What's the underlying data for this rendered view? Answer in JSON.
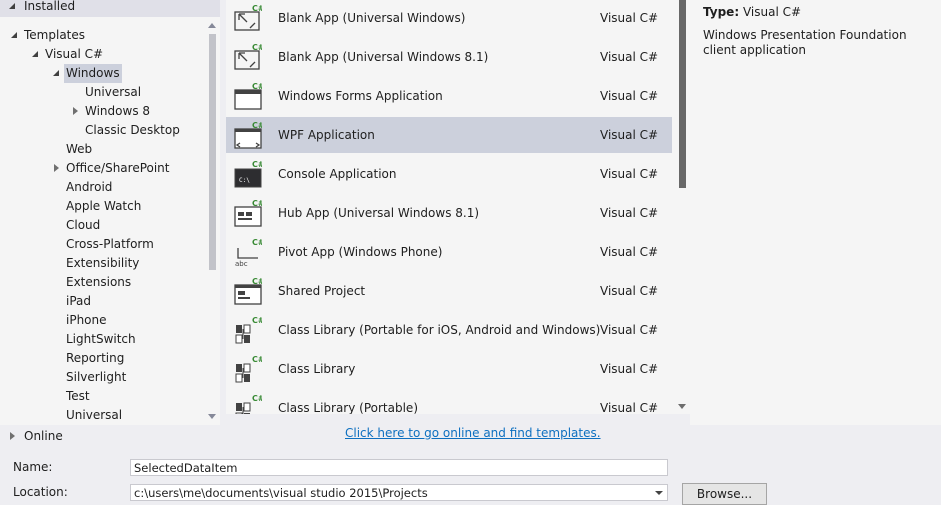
{
  "tree": {
    "installed": "Installed",
    "items": [
      {
        "label": "Templates",
        "state": "expanded"
      },
      {
        "label": "Visual C#",
        "state": "expanded"
      },
      {
        "label": "Windows",
        "state": "expanded",
        "selected": true
      },
      {
        "label": "Universal",
        "state": "leaf"
      },
      {
        "label": "Windows 8",
        "state": "collapsed"
      },
      {
        "label": "Classic Desktop",
        "state": "leaf"
      },
      {
        "label": "Web",
        "state": "leaf"
      },
      {
        "label": "Office/SharePoint",
        "state": "collapsed"
      },
      {
        "label": "Android",
        "state": "leaf"
      },
      {
        "label": "Apple Watch",
        "state": "leaf"
      },
      {
        "label": "Cloud",
        "state": "leaf"
      },
      {
        "label": "Cross-Platform",
        "state": "leaf"
      },
      {
        "label": "Extensibility",
        "state": "leaf"
      },
      {
        "label": "Extensions",
        "state": "leaf"
      },
      {
        "label": "iPad",
        "state": "leaf"
      },
      {
        "label": "iPhone",
        "state": "leaf"
      },
      {
        "label": "LightSwitch",
        "state": "leaf"
      },
      {
        "label": "Reporting",
        "state": "leaf"
      },
      {
        "label": "Silverlight",
        "state": "leaf"
      },
      {
        "label": "Test",
        "state": "leaf"
      },
      {
        "label": "Universal",
        "state": "leaf"
      }
    ],
    "online": "Online"
  },
  "templates": [
    {
      "name": "Blank App (Universal Windows)",
      "lang": "Visual C#",
      "icon": "blank-app-icon"
    },
    {
      "name": "Blank App (Universal Windows 8.1)",
      "lang": "Visual C#",
      "icon": "blank-app-icon"
    },
    {
      "name": "Windows Forms Application",
      "lang": "Visual C#",
      "icon": "window-icon"
    },
    {
      "name": "WPF Application",
      "lang": "Visual C#",
      "icon": "wpf-icon",
      "selected": true
    },
    {
      "name": "Console Application",
      "lang": "Visual C#",
      "icon": "console-icon"
    },
    {
      "name": "Hub App (Universal Windows 8.1)",
      "lang": "Visual C#",
      "icon": "hub-icon"
    },
    {
      "name": "Pivot App (Windows Phone)",
      "lang": "Visual C#",
      "icon": "pivot-icon"
    },
    {
      "name": "Shared Project",
      "lang": "Visual C#",
      "icon": "shared-icon"
    },
    {
      "name": "Class Library (Portable for iOS, Android and Windows)",
      "lang": "Visual C#",
      "icon": "class-library-icon"
    },
    {
      "name": "Class Library",
      "lang": "Visual C#",
      "icon": "class-library-icon"
    },
    {
      "name": "Class Library (Portable)",
      "lang": "Visual C#",
      "icon": "class-library-icon"
    }
  ],
  "icon_badge": "C#",
  "console_glyph": "C:\\",
  "pivot_glyph": "abc",
  "online_link": "Click here to go online and find templates.",
  "info": {
    "type_label": "Type:",
    "type_value": "Visual C#",
    "description": "Windows Presentation Foundation client application"
  },
  "form": {
    "name_label": "Name:",
    "name_value": "SelectedDataItem",
    "location_label": "Location:",
    "location_value": "c:\\users\\me\\documents\\visual studio 2015\\Projects",
    "browse_label": "Browse..."
  },
  "colors": {
    "selected_bg": "#ccd0dc",
    "link": "#0e70c0",
    "badge": "#388a34"
  }
}
